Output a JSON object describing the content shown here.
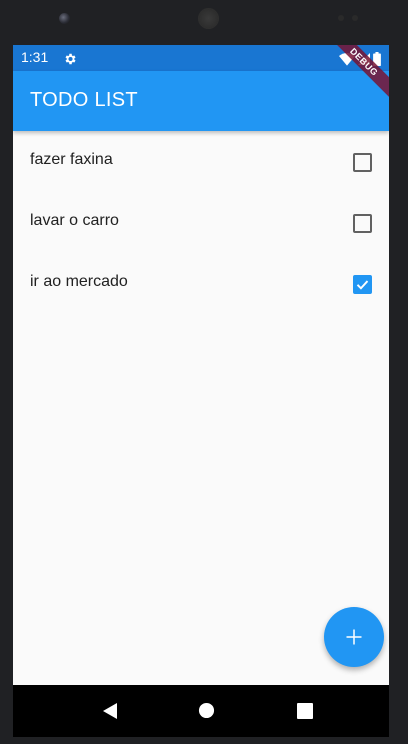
{
  "status_bar": {
    "time": "1:31",
    "icons": [
      "gear-icon",
      "wifi-icon",
      "signal-icon",
      "battery-icon"
    ]
  },
  "app_bar": {
    "title": "TODO LIST"
  },
  "debug_banner": {
    "label": "DEBUG"
  },
  "todos": [
    {
      "label": "fazer faxina",
      "checked": false
    },
    {
      "label": "lavar o carro",
      "checked": false
    },
    {
      "label": "ir ao mercado",
      "checked": true
    }
  ],
  "fab": {
    "icon": "plus-icon"
  },
  "nav_bar": {
    "icons": [
      "back-icon",
      "home-icon",
      "recents-icon"
    ]
  },
  "colors": {
    "primary": "#2196f3",
    "primary_dark": "#1976d2",
    "background": "#fafafa",
    "text": "#212121",
    "checkbox_border": "#616161"
  }
}
